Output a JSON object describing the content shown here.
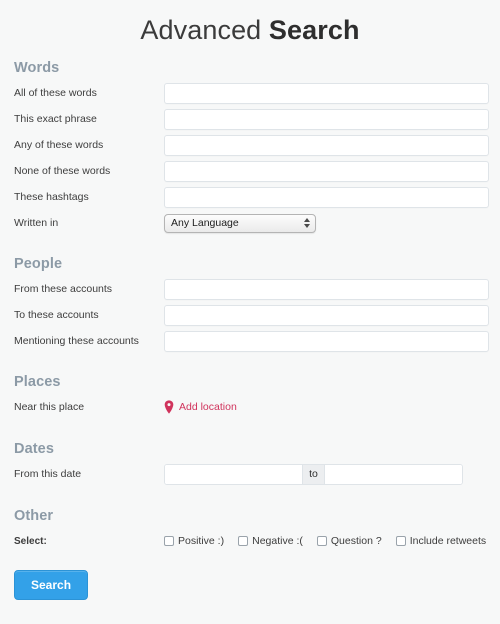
{
  "header": {
    "title_light": "Advanced",
    "title_bold": "Search"
  },
  "colors": {
    "background": "#f7f8f8",
    "section_heading": "#8c9aa6",
    "accent_link": "#d0335c",
    "button": "#33a1e8",
    "input_border": "#dfe4e8",
    "text": "#3d3d3d"
  },
  "sections": {
    "words": {
      "heading": "Words",
      "rows": [
        {
          "label": "All of these words",
          "value": "",
          "placeholder": ""
        },
        {
          "label": "This exact phrase",
          "value": "",
          "placeholder": ""
        },
        {
          "label": "Any of these words",
          "value": "",
          "placeholder": ""
        },
        {
          "label": "None of these words",
          "value": "",
          "placeholder": ""
        },
        {
          "label": "These hashtags",
          "value": "",
          "placeholder": ""
        }
      ],
      "language": {
        "label": "Written in",
        "selected": "Any Language",
        "icon": "updown-chevron-icon"
      }
    },
    "people": {
      "heading": "People",
      "rows": [
        {
          "label": "From these accounts",
          "value": "",
          "placeholder": ""
        },
        {
          "label": "To these accounts",
          "value": "",
          "placeholder": ""
        },
        {
          "label": "Mentioning these accounts",
          "value": "",
          "placeholder": ""
        }
      ]
    },
    "places": {
      "heading": "Places",
      "label": "Near this place",
      "link_text": "Add location",
      "link_icon": "map-pin-icon"
    },
    "dates": {
      "heading": "Dates",
      "label": "From this date",
      "from_value": "",
      "from_placeholder": "",
      "separator": "to",
      "to_value": "",
      "to_placeholder": ""
    },
    "other": {
      "heading": "Other",
      "label": "Select:",
      "checkboxes": [
        {
          "label": "Positive :)",
          "checked": false
        },
        {
          "label": "Negative :(",
          "checked": false
        },
        {
          "label": "Question ?",
          "checked": false
        },
        {
          "label": "Include retweets",
          "checked": false
        }
      ]
    }
  },
  "submit": {
    "label": "Search"
  }
}
